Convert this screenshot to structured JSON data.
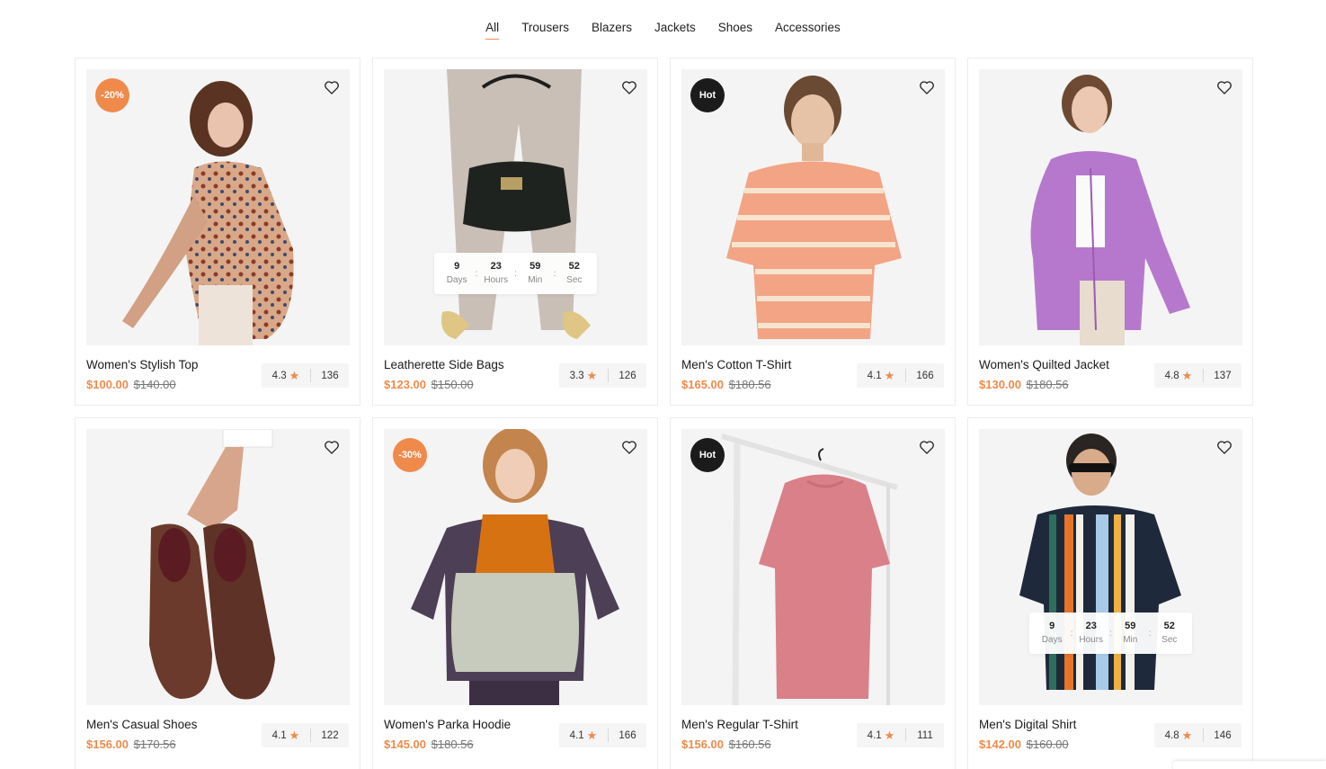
{
  "filters": {
    "items": [
      {
        "label": "All",
        "active": true
      },
      {
        "label": "Trousers"
      },
      {
        "label": "Blazers"
      },
      {
        "label": "Jackets"
      },
      {
        "label": "Shoes"
      },
      {
        "label": "Accessories"
      }
    ]
  },
  "countdown_labels": {
    "days": "Days",
    "hours": "Hours",
    "min": "Min",
    "sec": "Sec"
  },
  "products": [
    {
      "name": "Women's Stylish Top",
      "price": "$100.00",
      "old_price": "$140.00",
      "rating": "4.3",
      "reviews": "136",
      "badge": "-20%",
      "badge_type": "sale",
      "image": "woman-leopard-blouse"
    },
    {
      "name": "Leatherette Side Bags",
      "price": "$123.00",
      "old_price": "$150.00",
      "rating": "3.3",
      "reviews": "126",
      "countdown": {
        "days": "9",
        "hours": "23",
        "min": "59",
        "sec": "52"
      },
      "image": "black-handbag"
    },
    {
      "name": "Men's Cotton T-Shirt",
      "price": "$165.00",
      "old_price": "$180.56",
      "rating": "4.1",
      "reviews": "166",
      "badge": "Hot",
      "badge_type": "hot",
      "image": "man-striped-tshirt"
    },
    {
      "name": "Women's Quilted Jacket",
      "price": "$130.00",
      "old_price": "$180.56",
      "rating": "4.8",
      "reviews": "137",
      "image": "woman-purple-jacket"
    },
    {
      "name": "Men's Casual Shoes",
      "price": "$156.00",
      "old_price": "$170.56",
      "rating": "4.1",
      "reviews": "122",
      "image": "hand-holding-shoes"
    },
    {
      "name": "Women's Parka Hoodie",
      "price": "$145.00",
      "old_price": "$180.56",
      "rating": "4.1",
      "reviews": "166",
      "badge": "-30%",
      "badge_type": "sale",
      "image": "woman-parka"
    },
    {
      "name": "Men's Regular T-Shirt",
      "price": "$156.00",
      "old_price": "$160.56",
      "rating": "4.1",
      "reviews": "111",
      "badge": "Hot",
      "badge_type": "hot",
      "image": "pink-tshirt-hanger"
    },
    {
      "name": "Men's Digital Shirt",
      "price": "$142.00",
      "old_price": "$160.00",
      "rating": "4.8",
      "reviews": "146",
      "countdown": {
        "days": "9",
        "hours": "23",
        "min": "59",
        "sec": "52"
      },
      "image": "man-striped-shirt"
    }
  ],
  "colors": {
    "accent": "#f08a4b",
    "hot": "#1b1b1b"
  }
}
